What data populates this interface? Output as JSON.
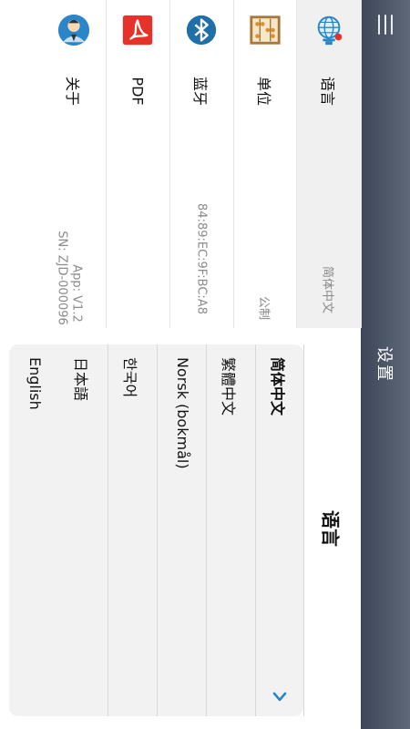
{
  "topbar": {
    "title": "设置"
  },
  "settings": {
    "items": [
      {
        "label": "语言",
        "value": "简体中文"
      },
      {
        "label": "单位",
        "value": "公制"
      },
      {
        "label": "蓝牙",
        "value": "84:89:EC:9F:BC:A8"
      },
      {
        "label": "PDF",
        "value": ""
      },
      {
        "label": "关于",
        "value_line1": "App: V1.2",
        "value_line2": "SN: ZJD-000096"
      }
    ]
  },
  "language_dialog": {
    "title": "语言",
    "options": [
      "简体中文",
      "繁體中文",
      "Norsk (bokmål)",
      "한국어",
      "日本語",
      "English"
    ],
    "selected": "简体中文"
  },
  "colors": {
    "accent": "#2a86c9",
    "pdf_red": "#e5332a",
    "bluetooth_blue": "#1f6fa8",
    "topbar": "#4b5466"
  }
}
